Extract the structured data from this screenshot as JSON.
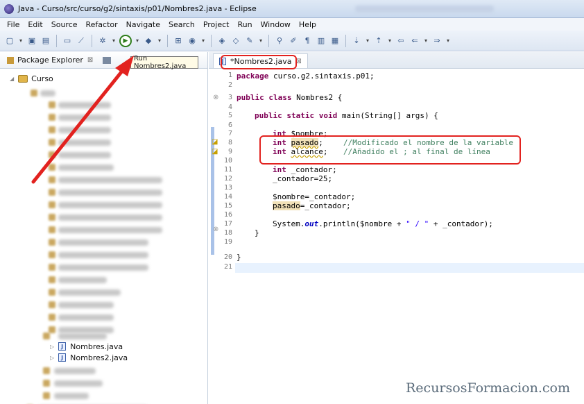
{
  "window": {
    "title": "Java - Curso/src/curso/g2/sintaxis/p01/Nombres2.java - Eclipse"
  },
  "menu": [
    "File",
    "Edit",
    "Source",
    "Refactor",
    "Navigate",
    "Search",
    "Project",
    "Run",
    "Window",
    "Help"
  ],
  "tooltip": {
    "text": "Run Nombres2.java"
  },
  "package_explorer": {
    "tab_label": "Package Explorer",
    "tab_close": "⊠",
    "project": "Curso",
    "files": [
      "Nombres.java",
      "Nombres2.java"
    ]
  },
  "editor": {
    "tab_label": "*Nombres2.java",
    "tab_close": "⊠",
    "line_numbers": [
      "1",
      "2",
      "3",
      "4",
      "5",
      "6",
      "7",
      "8",
      "9",
      "10",
      "11",
      "12",
      "13",
      "14",
      "15",
      "16",
      "17",
      "18",
      "19",
      "20",
      "21"
    ],
    "code": {
      "l1_kw": "package",
      "l1_rest": " curso.g2.sintaxis.p01;",
      "l3_kw": "public class",
      "l3_rest": " Nombres2 {",
      "l5_kw": "public static void",
      "l5_rest": " main(String[] args) {",
      "l7_kw": "int",
      "l7_rest": " $nombre;",
      "l8_kw": "int",
      "l8_var": "pasado",
      "l8_semi": ";",
      "l8_comment": "//Modificado el nombre de la variable",
      "l9_kw": "int",
      "l9_var": "alcance",
      "l9_semi": ";",
      "l9_comment": "//Añadido el ; al final de línea",
      "l11_kw": "int",
      "l11_rest": " _contador;",
      "l12": "_contador=25;",
      "l14": "$nombre=_contador;",
      "l15_var": "pasado",
      "l15_rest": "=_contador;",
      "l17_a": "System.",
      "l17_out": "out",
      "l17_b": ".println($nombre + ",
      "l17_str": "\" / \"",
      "l17_c": " + _contador);",
      "l18": "}",
      "l20": "}"
    }
  },
  "watermark": "RecursosFormacion.com",
  "colors": {
    "annotation": "#e2221f",
    "keyword": "#7f0055",
    "comment": "#3f7f5f",
    "string": "#2a00ff"
  }
}
